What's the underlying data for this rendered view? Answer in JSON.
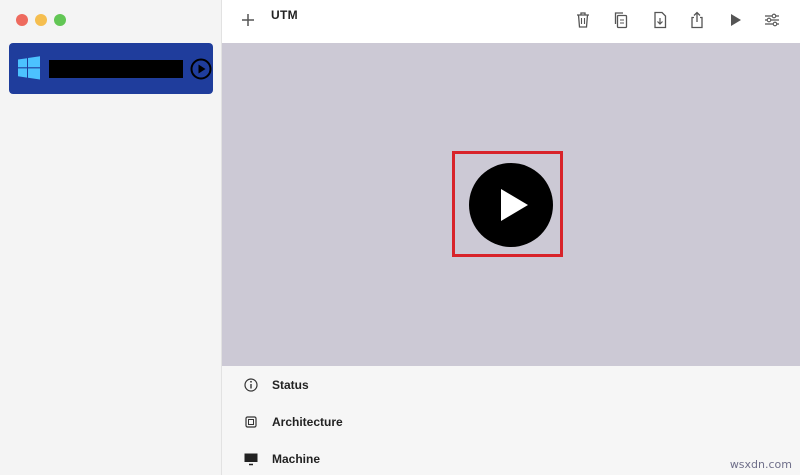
{
  "window": {
    "title": "UTM"
  },
  "sidebar": {
    "vm_items": [
      {
        "name": "",
        "os_icon": "windows-logo-icon",
        "selected": true
      }
    ]
  },
  "toolbar": {
    "icons": [
      "add-icon",
      "trash-icon",
      "clone-icon",
      "download-icon",
      "share-icon",
      "play-icon",
      "settings-sliders-icon"
    ]
  },
  "preview": {
    "play_icon": "large-play-icon",
    "highlight_color": "#d8232a"
  },
  "info": {
    "rows": [
      {
        "icon": "info-icon",
        "label": "Status"
      },
      {
        "icon": "chip-icon",
        "label": "Architecture"
      },
      {
        "icon": "monitor-icon",
        "label": "Machine"
      }
    ]
  },
  "colors": {
    "selection": "#1f3d9c",
    "preview_background": "#ccc9d5"
  },
  "watermark": "wsxdn.com"
}
